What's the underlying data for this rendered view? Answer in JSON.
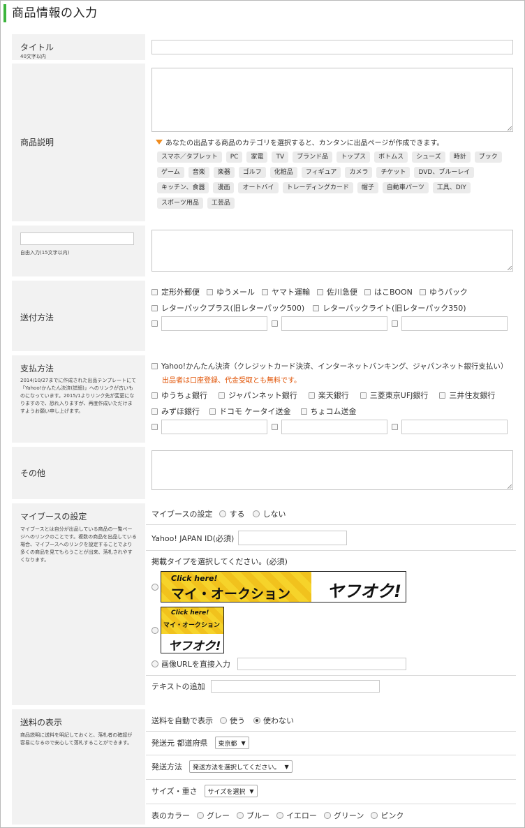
{
  "page_title": "商品情報の入力",
  "title_section": {
    "label": "タイトル",
    "note": "40文字以内"
  },
  "description_section": {
    "label": "商品説明",
    "hint": "あなたの出品する商品のカテゴリを選択すると、カンタンに出品ページが作成できます。",
    "tags": [
      "スマホ／タブレット",
      "PC",
      "家電",
      "TV",
      "ブランド品",
      "トップス",
      "ボトムス",
      "シューズ",
      "時計",
      "ブック",
      "ゲーム",
      "音楽",
      "楽器",
      "ゴルフ",
      "化粧品",
      "フィギュア",
      "カメラ",
      "チケット",
      "DVD、ブルーレイ",
      "キッチン、食器",
      "漫画",
      "オートバイ",
      "トレーディングカード",
      "帽子",
      "自動車パーツ",
      "工具、DIY",
      "スポーツ用品",
      "工芸品"
    ]
  },
  "free_section": {
    "note": "自由入力(15文字以内)"
  },
  "shipping_section": {
    "label": "送付方法",
    "row1": [
      "定形外郵便",
      "ゆうメール",
      "ヤマト運輸",
      "佐川急便",
      "はこBOON",
      "ゆうパック"
    ],
    "row2": [
      "レターパックプラス(旧レターパック500)",
      "レターパックライト(旧レターパック350)"
    ]
  },
  "payment_section": {
    "label": "支払方法",
    "note": "2014/10/27までに作成された出品テンプレートにて「Yahoo!かんたん決済(詳細)」へのリンクが古いものになっています。2015/1よりリンク先が変更になりますので、恐れ入りますが、再度作成いただけますようお願い申し上げます。",
    "yahoo": "Yahoo!かんたん決済（クレジットカード決済、インターネットバンキング、ジャパンネット銀行支払い）",
    "warning": "出品者は口座登録、代金受取とも無料です。",
    "row1": [
      "ゆうちょ銀行",
      "ジャパンネット銀行",
      "楽天銀行",
      "三菱東京UFJ銀行",
      "三井住友銀行"
    ],
    "row2": [
      "みずほ銀行",
      "ドコモ ケータイ送金",
      "ちょコム送金"
    ]
  },
  "other_section": {
    "label": "その他"
  },
  "mybooth_section": {
    "label": "マイブースの設定",
    "note": "マイブースとは自分が出品している商品の一覧ページへのリンクのことです。複数の商品を出品している場合、マイブースへのリンクを設定することでより多くの商品を見てもらうことが出来、落札されやすくなります。",
    "setting_label": "マイブースの設定",
    "opt_yes": "する",
    "opt_no": "しない",
    "yahoo_id_label": "Yahoo! JAPAN ID(必須)",
    "type_label": "掲載タイプを選択してください。(必須)",
    "banner_click": "Click here!",
    "banner_title": "マイ・オークション",
    "banner_logo": "ヤフオク!",
    "image_url_label": "画像URLを直接入力",
    "text_add_label": "テキストの追加"
  },
  "postage_section": {
    "label": "送料の表示",
    "note": "商品説明に送料を明記しておくと、落札者の確認が容易になるので安心して落札することができます。",
    "auto_label": "送料を自動で表示",
    "use": "使う",
    "not_use": "使わない",
    "origin_label": "発送元 都道府県",
    "origin_value": "東京都",
    "method_label": "発送方法",
    "method_value": "発送方法を選択してください。",
    "size_label": "サイズ・重さ",
    "size_value": "サイズを選択",
    "color_label": "表のカラー",
    "colors": [
      "グレー",
      "ブルー",
      "イエロー",
      "グリーン",
      "ピンク"
    ]
  },
  "colors": {
    "accent_bar": "#3cb43c",
    "warning_text": "#e05000",
    "label_bg": "#f2f2f2"
  }
}
